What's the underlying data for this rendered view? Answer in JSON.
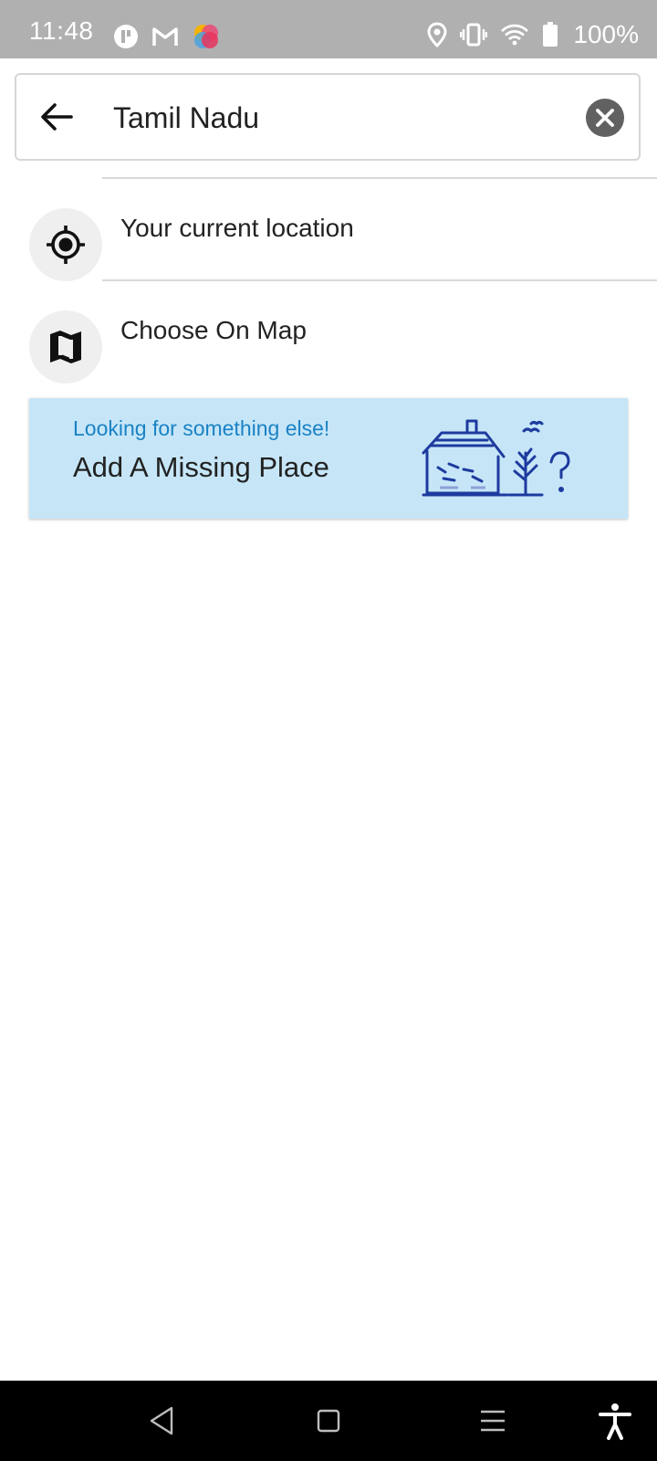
{
  "status_bar": {
    "time": "11:48",
    "battery": "100%",
    "left_icons": [
      "app-icon",
      "gmail-icon",
      "photos-icon"
    ],
    "right_icons": [
      "location-icon",
      "vibrate-icon",
      "wifi-icon",
      "battery-icon"
    ]
  },
  "search": {
    "value": "Tamil Nadu",
    "back_icon": "arrow-left-icon",
    "clear_icon": "close-icon"
  },
  "options": {
    "current_location": {
      "label": "Your current location",
      "icon": "crosshair-icon"
    },
    "choose_on_map": {
      "label": "Choose On Map",
      "icon": "map-icon"
    }
  },
  "missing_place": {
    "subtitle": "Looking for something else!",
    "title": "Add A Missing Place",
    "illustration": "house-tree-question-illustration"
  },
  "colors": {
    "status_bar": "#b0b0b0",
    "card_background": "#c6e6f8",
    "card_subtitle": "#1a82c4",
    "illustration_stroke": "#1d3b9e"
  },
  "nav_bar": {
    "buttons": [
      "back-triangle-icon",
      "home-square-icon",
      "menu-lines-icon",
      "accessibility-icon"
    ]
  }
}
